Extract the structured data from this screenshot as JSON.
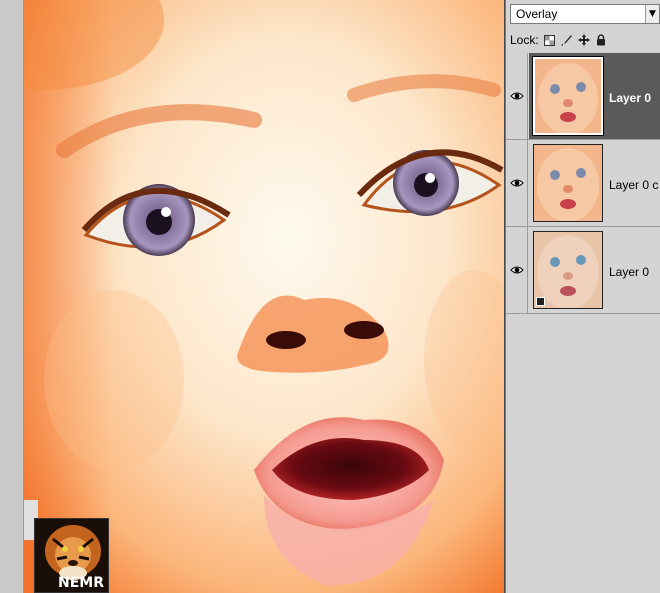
{
  "panel": {
    "blend_mode": "Overlay",
    "lock_label": "Lock:",
    "layers": [
      {
        "name": "Layer 0",
        "selected": true
      },
      {
        "name": "Layer 0 c",
        "selected": false
      },
      {
        "name": "Layer 0",
        "selected": false
      }
    ]
  },
  "watermark": {
    "text": "NEMR"
  },
  "colors": {
    "panel_bg": "#d4d4d4",
    "selected_layer": "#5a5a5a",
    "divider": "#7a7a7a"
  },
  "icons": [
    "eye-icon",
    "lock-transparent-icon",
    "lock-paint-icon",
    "lock-move-icon",
    "lock-all-icon",
    "dropdown-arrow-icon"
  ]
}
